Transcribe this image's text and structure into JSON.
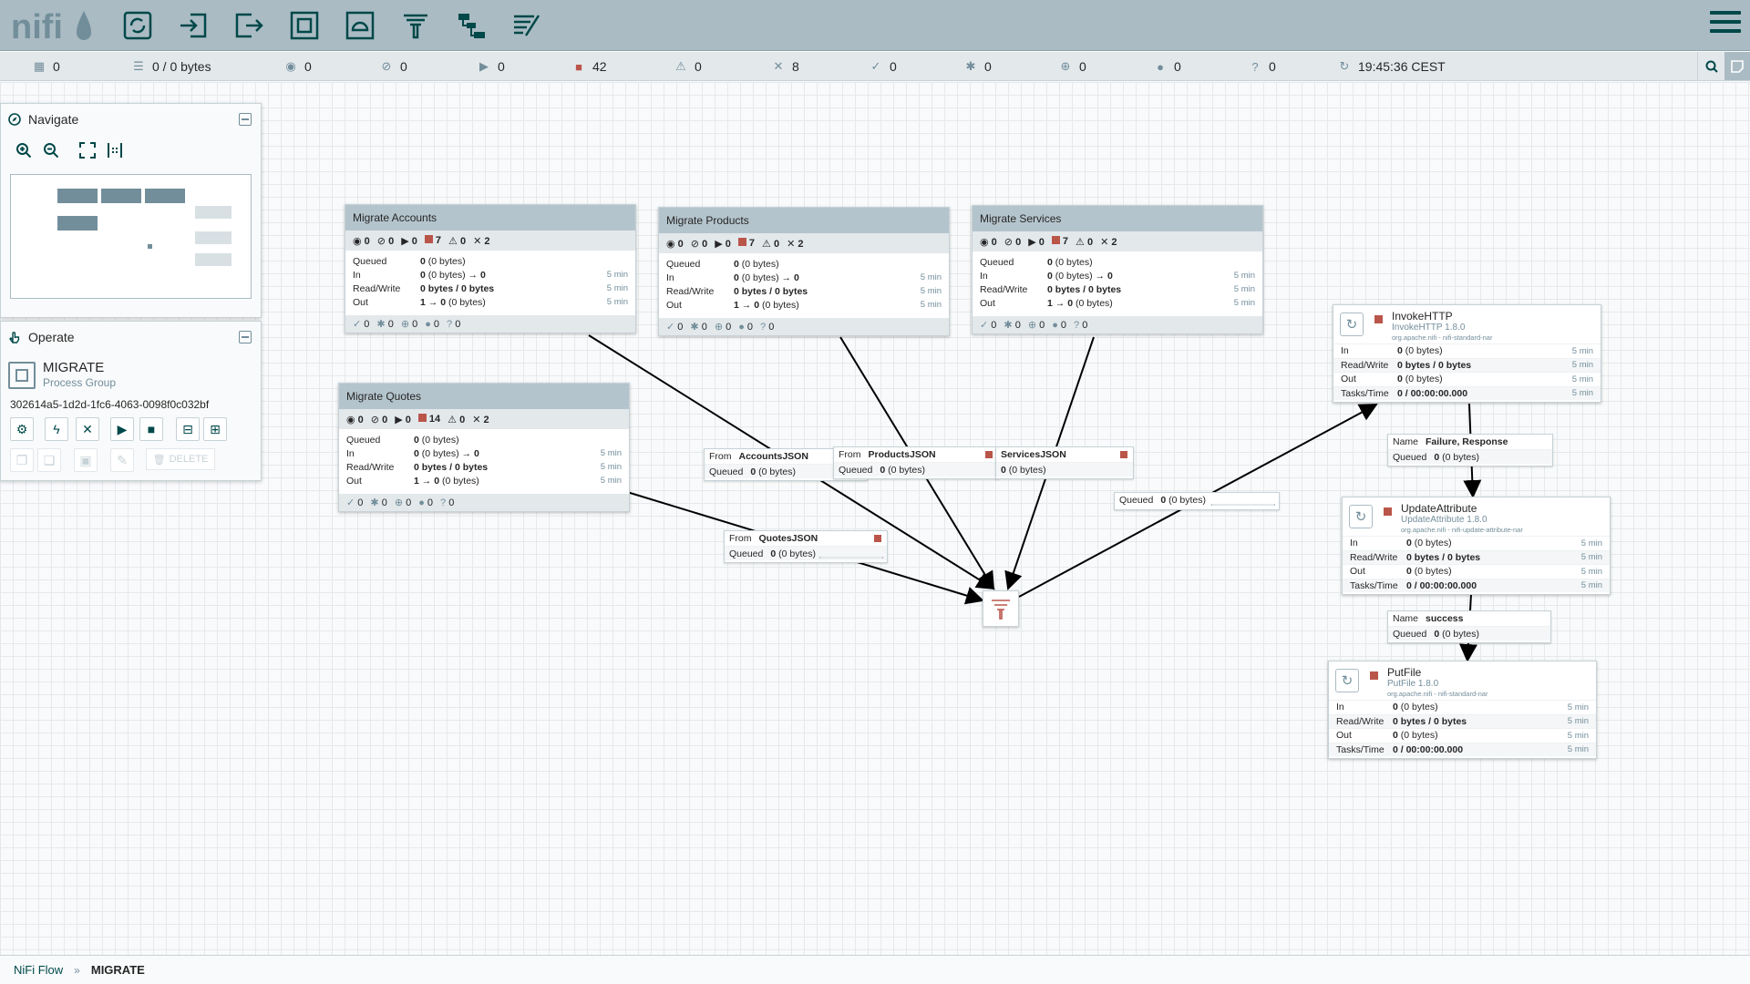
{
  "header": {
    "logo_text": "nifi",
    "toolbar": [
      "processor",
      "input-port",
      "output-port",
      "process-group",
      "remote-process-group",
      "funnel",
      "template",
      "label"
    ]
  },
  "status": {
    "active_threads": "0",
    "queued": "0 / 0 bytes",
    "transmitting": "0",
    "not_transmitting": "0",
    "running": "0",
    "stopped": "42",
    "invalid": "0",
    "disabled": "8",
    "up_to_date": "0",
    "locally_modified": "0",
    "stale": "0",
    "modified_stale": "0",
    "sync_failure": "0",
    "last_refresh": "19:45:36 CEST"
  },
  "navigate": {
    "title": "Navigate"
  },
  "operate": {
    "title": "Operate",
    "name": "MIGRATE",
    "type": "Process Group",
    "id": "302614a5-1d2d-1fc6-4063-0098f0c032bf",
    "delete_label": "DELETE"
  },
  "process_groups": [
    {
      "name": "Migrate Accounts",
      "stats": [
        "0",
        "0",
        "0",
        "7",
        "0",
        "2"
      ],
      "queued": "0",
      "queued_bytes": "(0 bytes)",
      "in": "0",
      "in_bytes": "(0 bytes)",
      "in_arrow": "0",
      "rw": "0 bytes / 0 bytes",
      "out": "1",
      "out_arrow": "0",
      "out_bytes": "(0 bytes)",
      "time": "5 min",
      "foot": [
        "0",
        "0",
        "0",
        "0",
        "0",
        "0"
      ]
    },
    {
      "name": "Migrate Products",
      "stats": [
        "0",
        "0",
        "0",
        "7",
        "0",
        "2"
      ],
      "queued": "0",
      "queued_bytes": "(0 bytes)",
      "in": "0",
      "in_bytes": "(0 bytes)",
      "in_arrow": "0",
      "rw": "0 bytes / 0 bytes",
      "out": "1",
      "out_arrow": "0",
      "out_bytes": "(0 bytes)",
      "time": "5 min",
      "foot": [
        "0",
        "0",
        "0",
        "0",
        "0",
        "0"
      ]
    },
    {
      "name": "Migrate Services",
      "stats": [
        "0",
        "0",
        "0",
        "7",
        "0",
        "2"
      ],
      "queued": "0",
      "queued_bytes": "(0 bytes)",
      "in": "0",
      "in_bytes": "(0 bytes)",
      "in_arrow": "0",
      "rw": "0 bytes / 0 bytes",
      "out": "1",
      "out_arrow": "0",
      "out_bytes": "(0 bytes)",
      "time": "5 min",
      "foot": [
        "0",
        "0",
        "0",
        "0",
        "0",
        "0"
      ]
    },
    {
      "name": "Migrate Quotes",
      "stats": [
        "0",
        "0",
        "0",
        "14",
        "0",
        "2"
      ],
      "queued": "0",
      "queued_bytes": "(0 bytes)",
      "in": "0",
      "in_bytes": "(0 bytes)",
      "in_arrow": "0",
      "rw": "0 bytes / 0 bytes",
      "out": "1",
      "out_arrow": "0",
      "out_bytes": "(0 bytes)",
      "time": "5 min",
      "foot": [
        "0",
        "0",
        "0",
        "0",
        "0",
        "0"
      ]
    }
  ],
  "labels": {
    "queued": "Queued",
    "in": "In",
    "read_write": "Read/Write",
    "out": "Out",
    "tasks_time": "Tasks/Time",
    "from": "From",
    "name": "Name",
    "arrow": "→"
  },
  "processors": [
    {
      "name": "InvokeHTTP",
      "type": "InvokeHTTP 1.8.0",
      "bundle": "org.apache.nifi - nifi-standard-nar",
      "in": "0",
      "in_bytes": "(0 bytes)",
      "rw": "0 bytes / 0 bytes",
      "out": "0",
      "out_bytes": "(0 bytes)",
      "tasks": "0 / 00:00:00.000",
      "time": "5 min"
    },
    {
      "name": "UpdateAttribute",
      "type": "UpdateAttribute 1.8.0",
      "bundle": "org.apache.nifi - nifi-update-attribute-nar",
      "in": "0",
      "in_bytes": "(0 bytes)",
      "rw": "0 bytes / 0 bytes",
      "out": "0",
      "out_bytes": "(0 bytes)",
      "tasks": "0 / 00:00:00.000",
      "time": "5 min"
    },
    {
      "name": "PutFile",
      "type": "PutFile 1.8.0",
      "bundle": "org.apache.nifi - nifi-standard-nar",
      "in": "0",
      "in_bytes": "(0 bytes)",
      "rw": "0 bytes / 0 bytes",
      "out": "0",
      "out_bytes": "(0 bytes)",
      "tasks": "0 / 00:00:00.000",
      "time": "5 min"
    }
  ],
  "connections": [
    {
      "from": "AccountsJSON",
      "queued": "0",
      "queued_bytes": "(0 bytes)"
    },
    {
      "from": "ProductsJSON",
      "queued": "0",
      "queued_bytes": "(0 bytes)"
    },
    {
      "from": "ServicesJSON",
      "queued": "0",
      "queued_bytes": "(0 bytes)"
    },
    {
      "from": "QuotesJSON",
      "queued": "0",
      "queued_bytes": "(0 bytes)"
    },
    {
      "queued": "0",
      "queued_bytes": "(0 bytes)"
    },
    {
      "name": "Failure, Response",
      "queued": "0",
      "queued_bytes": "(0 bytes)"
    },
    {
      "name": "success",
      "queued": "0",
      "queued_bytes": "(0 bytes)"
    }
  ],
  "breadcrumbs": [
    "NiFi Flow",
    "MIGRATE"
  ],
  "breadcrumb_sep": "»"
}
